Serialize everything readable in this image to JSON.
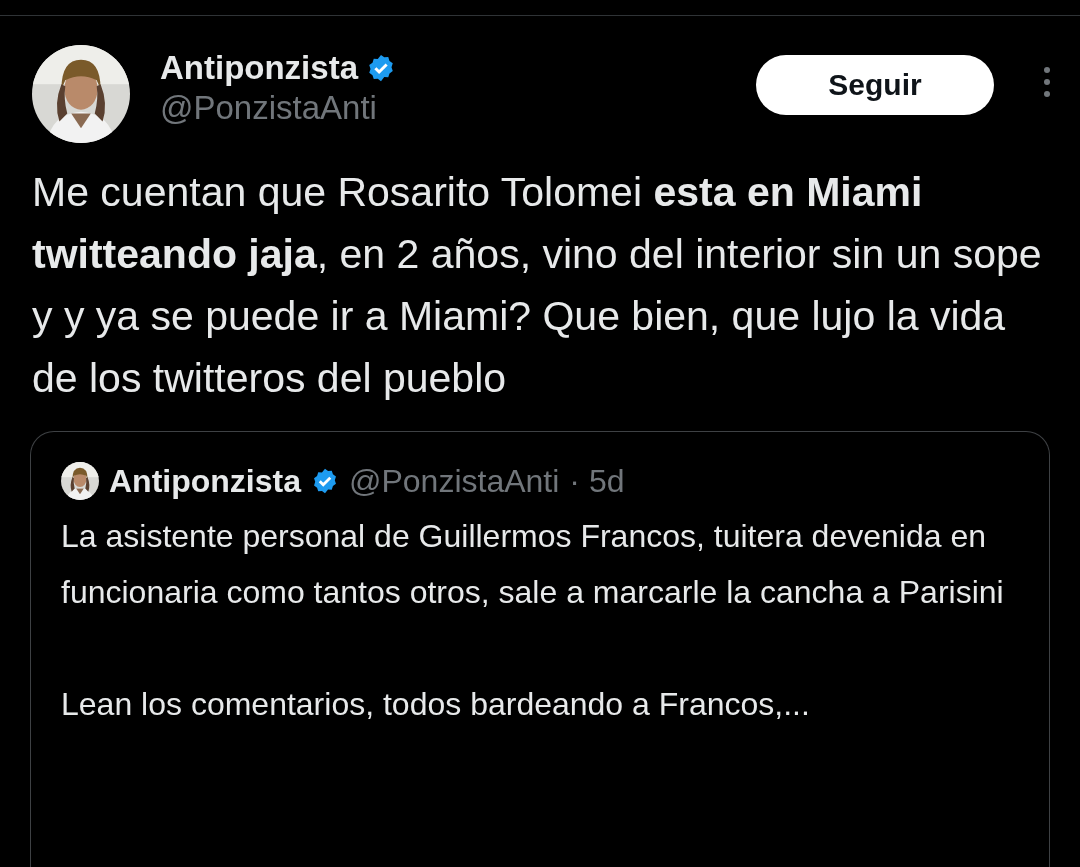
{
  "post": {
    "author": {
      "name": "Antiponzista",
      "handle": "@PonzistaAnti",
      "verified": true
    },
    "follow_button": "Seguir",
    "text": "Me cuentan que Rosarito Tolomei **esta en Miami twitteando jaja**, en 2 años, vino del interior sin un sope y y ya se puede ir a Miami? Que bien, que lujo la vida de los twitteros del pueblo",
    "quoted": {
      "author": {
        "name": "Antiponzista",
        "handle": "@PonzistaAnti",
        "verified": true
      },
      "time": "· 5d",
      "paragraphs": [
        "La asistente personal de Guillermos Francos, tuitera devenida en funcionaria como tantos otros, sale a marcarle la cancha a Parisini",
        "Lean los comentarios, todos bardeando a Francos,..."
      ]
    }
  }
}
